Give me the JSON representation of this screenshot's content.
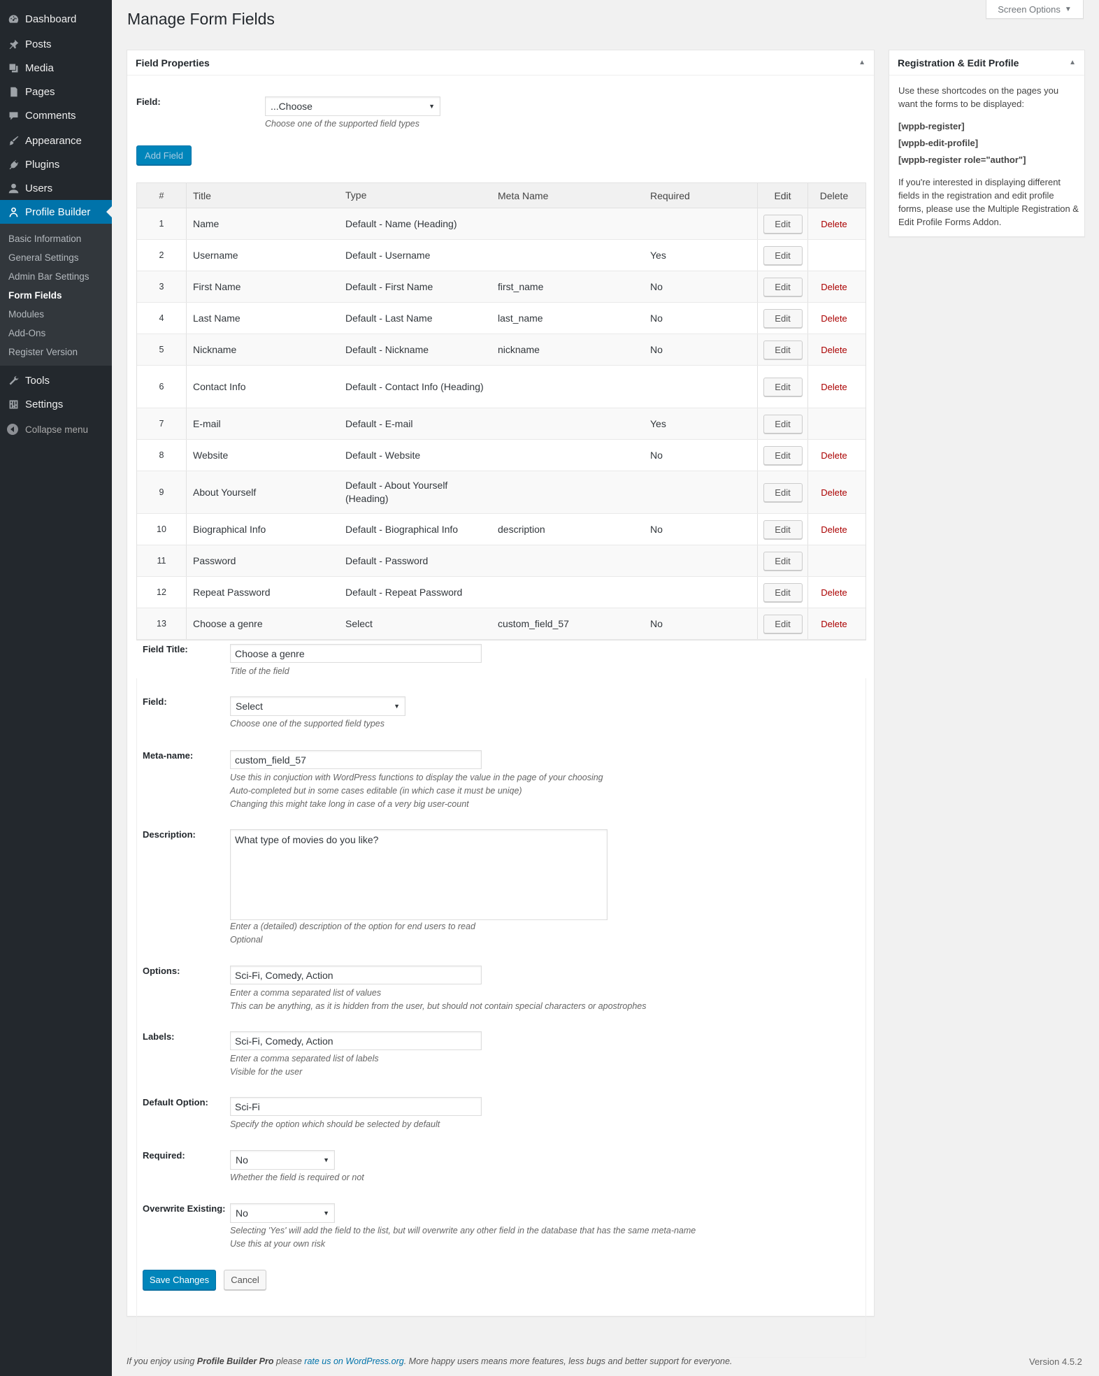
{
  "sidebar": {
    "items_top": [
      {
        "label": "Dashboard",
        "icon": "dashboard-icon"
      },
      {
        "label": "Posts",
        "icon": "pin-icon"
      },
      {
        "label": "Media",
        "icon": "media-icon"
      },
      {
        "label": "Pages",
        "icon": "pages-icon"
      },
      {
        "label": "Comments",
        "icon": "comments-icon"
      },
      {
        "label": "Appearance",
        "icon": "brush-icon"
      },
      {
        "label": "Plugins",
        "icon": "plug-icon"
      },
      {
        "label": "Users",
        "icon": "user-icon"
      },
      {
        "label": "Profile Builder",
        "icon": "profile-icon"
      }
    ],
    "submenu": [
      "Basic Information",
      "General Settings",
      "Admin Bar Settings",
      "Form Fields",
      "Modules",
      "Add-Ons",
      "Register Version"
    ],
    "items_bottom": [
      {
        "label": "Tools",
        "icon": "wrench-icon"
      },
      {
        "label": "Settings",
        "icon": "settings-icon"
      }
    ],
    "collapse_label": "Collapse menu",
    "active_color": "#0073aa"
  },
  "header": {
    "title": "Manage Form Fields",
    "screen_options": "Screen Options"
  },
  "field_properties": {
    "title": "Field Properties",
    "field_label": "Field:",
    "field_select": "...Choose",
    "field_help": "Choose one of the supported field types",
    "add_button": "Add Field"
  },
  "table": {
    "headers": [
      "#",
      "Title",
      "Type",
      "Meta Name",
      "Required",
      "Edit",
      "Delete"
    ],
    "edit_label": "Edit",
    "delete_label": "Delete",
    "rows": [
      {
        "num": "1",
        "title": "Name",
        "type": "Default - Name (Heading)",
        "meta": "",
        "required": "",
        "deletable": true
      },
      {
        "num": "2",
        "title": "Username",
        "type": "Default - Username",
        "meta": "",
        "required": "Yes",
        "deletable": false
      },
      {
        "num": "3",
        "title": "First Name",
        "type": "Default - First Name",
        "meta": "first_name",
        "required": "No",
        "deletable": true
      },
      {
        "num": "4",
        "title": "Last Name",
        "type": "Default - Last Name",
        "meta": "last_name",
        "required": "No",
        "deletable": true
      },
      {
        "num": "5",
        "title": "Nickname",
        "type": "Default - Nickname",
        "meta": "nickname",
        "required": "No",
        "deletable": true
      },
      {
        "num": "6",
        "title": "Contact Info",
        "type": "Default - Contact Info (Heading)",
        "meta": "",
        "required": "",
        "deletable": true
      },
      {
        "num": "7",
        "title": "E-mail",
        "type": "Default - E-mail",
        "meta": "",
        "required": "Yes",
        "deletable": false
      },
      {
        "num": "8",
        "title": "Website",
        "type": "Default - Website",
        "meta": "",
        "required": "No",
        "deletable": true
      },
      {
        "num": "9",
        "title": "About Yourself",
        "type": "Default - About Yourself (Heading)",
        "meta": "",
        "required": "",
        "deletable": true
      },
      {
        "num": "10",
        "title": "Biographical Info",
        "type": "Default - Biographical Info",
        "meta": "description",
        "required": "No",
        "deletable": true
      },
      {
        "num": "11",
        "title": "Password",
        "type": "Default - Password",
        "meta": "",
        "required": "",
        "deletable": false
      },
      {
        "num": "12",
        "title": "Repeat Password",
        "type": "Default - Repeat Password",
        "meta": "",
        "required": "",
        "deletable": true
      },
      {
        "num": "13",
        "title": "Choose a genre",
        "type": "Select",
        "meta": "custom_field_57",
        "required": "No",
        "deletable": true
      }
    ]
  },
  "edit_form": {
    "field_title_label": "Field Title:",
    "field_title_value": "Choose a genre",
    "field_title_help": "Title of the field",
    "field_label": "Field:",
    "field_value": "Select",
    "field_help": "Choose one of the supported field types",
    "meta_label": "Meta-name:",
    "meta_value": "custom_field_57",
    "meta_help_1": "Use this in conjuction with WordPress functions to display the value in the page of your choosing",
    "meta_help_2": "Auto-completed but in some cases editable (in which case it must be uniqe)",
    "meta_help_3": "Changing this might take long in case of a very big user-count",
    "description_label": "Description:",
    "description_value": "What type of movies do you like?",
    "description_help_1": "Enter a (detailed) description of the option for end users to read",
    "description_help_2": "Optional",
    "options_label": "Options:",
    "options_value": "Sci-Fi, Comedy, Action",
    "options_help_1": "Enter a comma separated list of values",
    "options_help_2": "This can be anything, as it is hidden from the user, but should not contain special characters or apostrophes",
    "labels_label": "Labels:",
    "labels_value": "Sci-Fi, Comedy, Action",
    "labels_help_1": "Enter a comma separated list of labels",
    "labels_help_2": "Visible for the user",
    "default_label": "Default Option:",
    "default_value": "Sci-Fi",
    "default_help": "Specify the option which should be selected by default",
    "required_label": "Required:",
    "required_value": "No",
    "required_help": "Whether the field is required or not",
    "overwrite_label": "Overwrite Existing:",
    "overwrite_value": "No",
    "overwrite_help_1": "Selecting 'Yes' will add the field to the list, but will overwrite any other field in the database that has the same meta-name",
    "overwrite_help_2": "Use this at your own risk",
    "save_button": "Save Changes",
    "cancel_button": "Cancel"
  },
  "side_box": {
    "title": "Registration & Edit Profile",
    "intro": "Use these shortcodes on the pages you want the forms to be displayed:",
    "shortcodes": [
      "[wppb-register]",
      "[wppb-edit-profile]",
      "[wppb-register role=\"author\"]"
    ],
    "note": "If you're interested in displaying different fields in the registration and edit profile forms, please use the Multiple Registration & Edit Profile Forms Addon."
  },
  "footer": {
    "text_1": "If you enjoy using ",
    "product": "Profile Builder Pro",
    "text_2": " please ",
    "link": "rate us on WordPress.org",
    "text_3": ". More happy users means more features, less bugs and better support for everyone.",
    "version": "Version 4.5.2"
  }
}
